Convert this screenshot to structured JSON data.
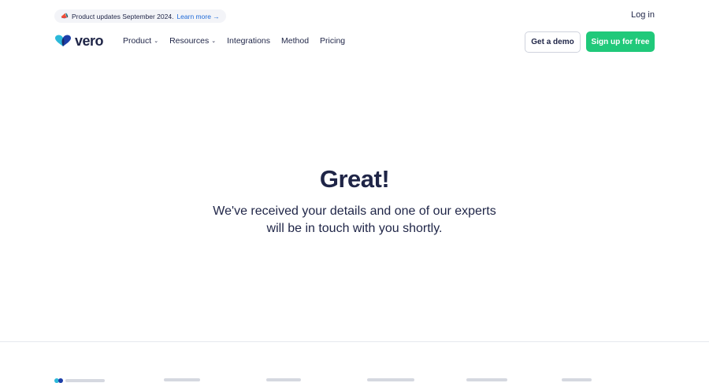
{
  "announcement": {
    "emoji": "📣",
    "text": "Product updates September 2024.",
    "link_label": "Learn more →"
  },
  "header": {
    "login_label": "Log in",
    "logo_text": "vero",
    "nav": [
      {
        "label": "Product",
        "has_dropdown": true
      },
      {
        "label": "Resources",
        "has_dropdown": true
      },
      {
        "label": "Integrations",
        "has_dropdown": false
      },
      {
        "label": "Method",
        "has_dropdown": false
      },
      {
        "label": "Pricing",
        "has_dropdown": false
      }
    ],
    "demo_button": "Get a demo",
    "signup_button": "Sign up for free"
  },
  "hero": {
    "title": "Great!",
    "message": "We've received your details and one of our experts will be in touch with you shortly."
  },
  "colors": {
    "primary_text": "#1f2547",
    "accent_green": "#20c97a",
    "link_blue": "#1f6ad8"
  }
}
